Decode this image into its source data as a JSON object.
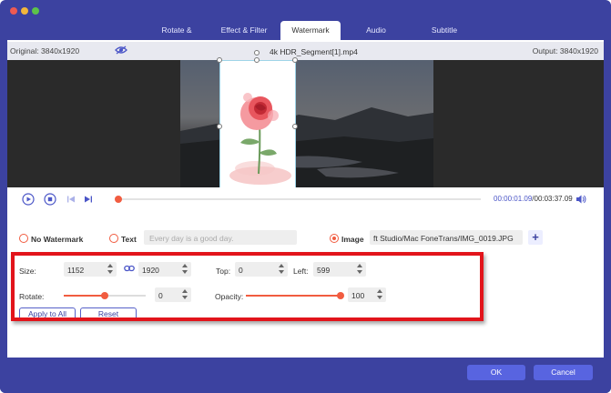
{
  "tabs": [
    {
      "label": "Rotate & Crop"
    },
    {
      "label": "Effect & Filter"
    },
    {
      "label": "Watermark"
    },
    {
      "label": "Audio"
    },
    {
      "label": "Subtitle"
    }
  ],
  "active_tab": "Watermark",
  "infobar": {
    "original": "Original: 3840x1920",
    "filename": "4k HDR_Segment[1].mp4",
    "output": "Output: 3840x1920"
  },
  "playback": {
    "current_time": "00:00:01.09",
    "total_time": "/00:03:37.09",
    "progress": 0.0
  },
  "watermark": {
    "no_watermark_label": "No Watermark",
    "text_label": "Text",
    "text_placeholder": "Every day is a good day.",
    "image_label": "Image",
    "image_path": "ft Studio/Mac FoneTrans/IMG_0019.JPG",
    "add_button": "+"
  },
  "settings": {
    "size_label": "Size:",
    "width": "1152",
    "height": "1920",
    "top_label": "Top:",
    "top": "0",
    "left_label": "Left:",
    "left": "599",
    "rotate_label": "Rotate:",
    "rotate": "0",
    "rotate_level": 0.5,
    "opacity_label": "Opacity:",
    "opacity": "100",
    "opacity_level": 1.0,
    "apply_all": "Apply to All",
    "reset": "Reset"
  },
  "footer": {
    "ok": "OK",
    "cancel": "Cancel"
  },
  "colors": {
    "frame": "#3c42a0",
    "accent": "#f15c40",
    "primary_button": "#5864e0",
    "highlight": "#e2141b"
  }
}
